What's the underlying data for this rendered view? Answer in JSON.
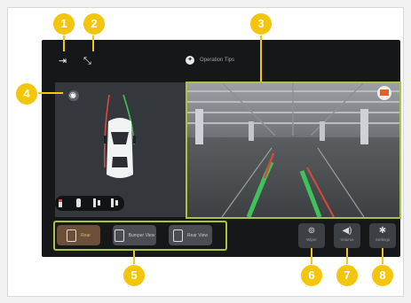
{
  "header": {
    "exit_icon": "⇥",
    "minimize_icon": "⤡",
    "tips_icon": "lightbulb-icon",
    "tips_label": "Operation Tips"
  },
  "views": [
    {
      "label": "Rear",
      "active": true
    },
    {
      "label": "Bumper View",
      "active": false
    },
    {
      "label": "Rear View",
      "active": false
    }
  ],
  "controls": [
    {
      "icon": "steering-wheel-icon",
      "glyph": "⊚",
      "label": "Wiper"
    },
    {
      "icon": "volume-icon",
      "glyph": "◀)",
      "label": "Volume"
    },
    {
      "icon": "settings-icon",
      "glyph": "✱",
      "label": "Settings"
    }
  ],
  "callouts": [
    "1",
    "2",
    "3",
    "4",
    "5",
    "6",
    "7",
    "8"
  ],
  "colors": {
    "callout": "#f3c60d",
    "highlight": "#a8c43d",
    "active": "#e3b46b"
  }
}
